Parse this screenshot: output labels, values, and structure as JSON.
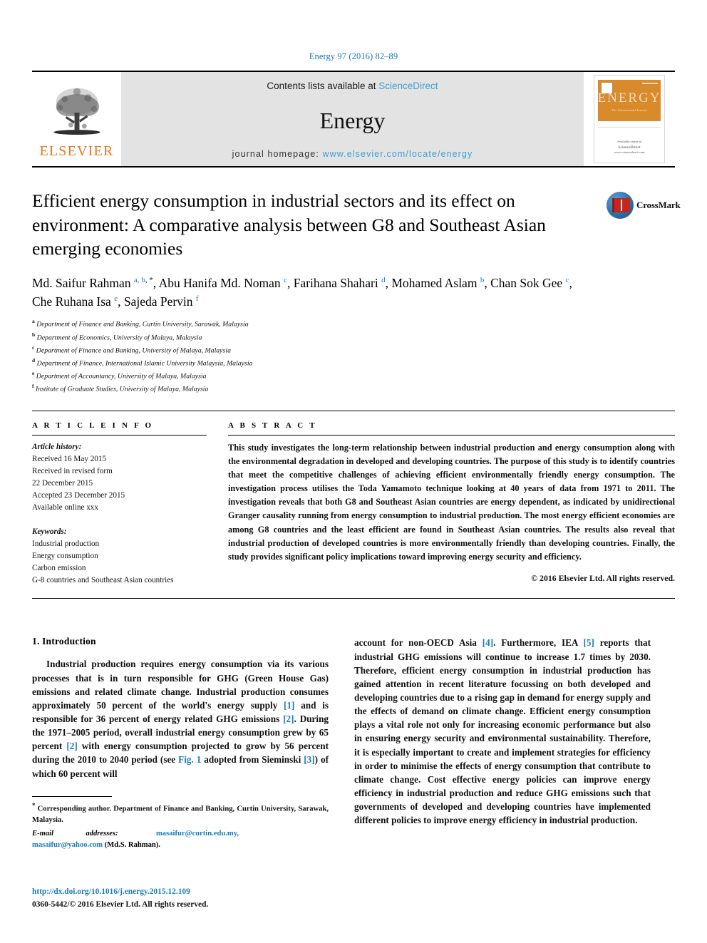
{
  "running_head": "Energy 97 (2016) 82–89",
  "masthead": {
    "publisher_name": "ELSEVIER",
    "contents_prefix": "Contents lists available at",
    "sciencedirect": "ScienceDirect",
    "journal_name": "Energy",
    "homepage_prefix": "journal homepage:",
    "homepage_url": "www.elsevier.com/locate/energy",
    "cover": {
      "title": "ENERGY",
      "subtitle": "The International Journal",
      "bottom_line1": "Available online at",
      "bottom_line2": "ScienceDirect",
      "bottom_line3": "www.sciencedirect.com"
    }
  },
  "article": {
    "title": "Efficient energy consumption in industrial sectors and its effect on environment: A comparative analysis between G8 and Southeast Asian emerging economies",
    "crossmark_label": "CrossMark",
    "authors_html": "Md. Saifur Rahman <sup class=\"aff-ref\">a, b</sup><sup class=\"corr-star\">, *</sup>, Abu Hanifa Md. Noman <sup class=\"aff-ref\">c</sup>, Farihana Shahari <sup class=\"aff-ref\">d</sup>, Mohamed Aslam <sup class=\"aff-ref\">b</sup>, Chan Sok Gee <sup class=\"aff-ref\">c</sup>, Che Ruhana Isa <sup class=\"aff-ref\">e</sup>, Sajeda Pervin <sup class=\"aff-ref\">f</sup>",
    "affiliations": [
      {
        "letter": "a",
        "text": "Department of Finance and Banking, Curtin University, Sarawak, Malaysia"
      },
      {
        "letter": "b",
        "text": "Department of Economics, University of Malaya, Malaysia"
      },
      {
        "letter": "c",
        "text": "Department of Finance and Banking, University of Malaya, Malaysia"
      },
      {
        "letter": "d",
        "text": "Department of Finance, International Islamic University Malaysia, Malaysia"
      },
      {
        "letter": "e",
        "text": "Department of Accountancy, University of Malaya, Malaysia"
      },
      {
        "letter": "f",
        "text": "Institute of Graduate Studies, University of Malaya, Malaysia"
      }
    ]
  },
  "article_info": {
    "heading": "A R T I C L E   I N F O",
    "history_label": "Article history:",
    "history_lines": [
      "Received 16 May 2015",
      "Received in revised form",
      "22 December 2015",
      "Accepted 23 December 2015",
      "Available online xxx"
    ],
    "keywords_label": "Keywords:",
    "keywords": [
      "Industrial production",
      "Energy consumption",
      "Carbon emission",
      "G-8 countries and Southeast Asian countries"
    ]
  },
  "abstract": {
    "heading": "A B S T R A C T",
    "text": "This study investigates the long-term relationship between industrial production and energy consumption along with the environmental degradation in developed and developing countries. The purpose of this study is to identify countries that meet the competitive challenges of achieving efficient environmentally friendly energy consumption. The investigation process utilises the Toda Yamamoto technique looking at 40 years of data from 1971 to 2011. The investigation reveals that both G8 and Southeast Asian countries are energy dependent, as indicated by unidirectional Granger causality running from energy consumption to industrial production. The most energy efficient economies are among G8 countries and the least efficient are found in Southeast Asian countries. The results also reveal that industrial production of developed countries is more environmentally friendly than developing countries. Finally, the study provides significant policy implications toward improving energy security and efficiency.",
    "copyright": "© 2016 Elsevier Ltd. All rights reserved."
  },
  "body": {
    "section_number_title": "1.  Introduction",
    "left_paragraph_html": "Industrial production requires energy consumption via its various processes that is in turn responsible for GHG (Green House Gas) emissions and related climate change. Industrial production consumes approximately 50 percent of the world's energy supply <span class=\"cite\">[1]</span> and is responsible for 36 percent of energy related GHG emissions <span class=\"cite\">[2]</span>. During the 1971&#8211;2005 period, overall industrial energy consumption grew by 65 percent <span class=\"cite\">[2]</span> with energy consumption projected to grow by 56 percent during the 2010 to 2040 period (see <span class=\"cite\">Fig. 1</span> adopted from Sieminski <span class=\"cite\">[3]</span>) of which 60 percent will",
    "right_paragraph_html": "account for non-OECD Asia <span class=\"cite\">[4]</span>. Furthermore, IEA <span class=\"cite\">[5]</span> reports that industrial GHG emissions will continue to increase 1.7 times by 2030. Therefore, efficient energy consumption in industrial production has gained attention in recent literature focussing on both developed and developing countries due to a rising gap in demand for energy supply and the effects of demand on climate change. Efficient energy consumption plays a vital role not only for increasing economic performance but also in ensuring energy security and environmental sustainability. Therefore, it is especially important to create and implement strategies for efficiency in order to minimise the effects of energy consumption that contribute to climate change. Cost effective energy policies can improve energy efficiency in industrial production and reduce GHG emissions such that governments of developed and developing countries have implemented different policies to improve energy efficiency in industrial production."
  },
  "footnotes": {
    "corresponding_html": "<span class=\"star\">*</span> Corresponding author. Department of Finance and Banking, Curtin University, Sarawak, Malaysia.",
    "email_label": "E-mail",
    "addresses_label": "addresses:",
    "email1": "masaifur@curtin.edu.my,",
    "email2": "masaifur@yahoo.com",
    "email_owner": "(Md.S. Rahman)."
  },
  "doi": {
    "url": "http://dx.doi.org/10.1016/j.energy.2015.12.109",
    "issn_line": "0360-5442/© 2016 Elsevier Ltd. All rights reserved."
  },
  "colors": {
    "link_blue": "#1a7bb9",
    "elsevier_orange": "#E87722",
    "masthead_gray": "#e3e3e3",
    "crossmark_red": "#c0271d"
  }
}
